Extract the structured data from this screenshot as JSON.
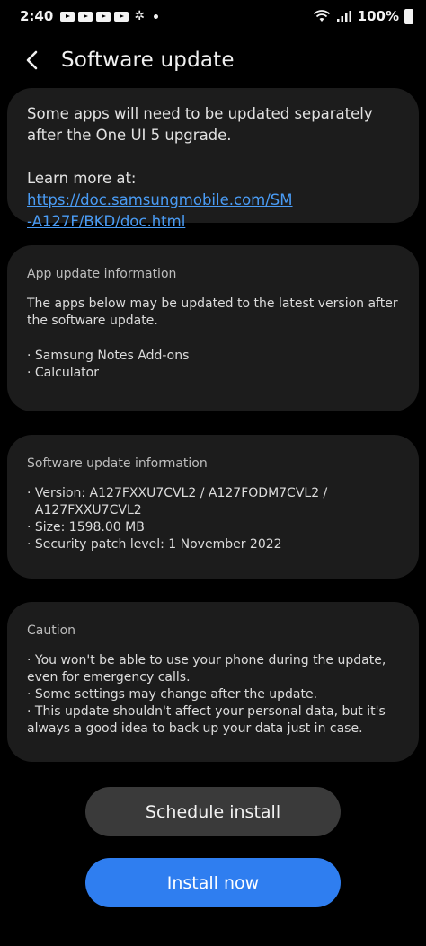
{
  "status_bar": {
    "time": "2:40",
    "battery": "100%",
    "left_icons": [
      "youtube-icon",
      "youtube-icon",
      "youtube-icon",
      "youtube-icon",
      "pinwheel-icon",
      "notification-dot-icon"
    ],
    "right_icons": [
      "wifi-icon",
      "signal-icon",
      "battery-icon"
    ]
  },
  "header": {
    "title": "Software update"
  },
  "notice_card": {
    "text": "Some apps will need to be updated separately after the One UI 5 upgrade.",
    "learn_more_label": "Learn more at: ",
    "link_line1": "https://doc.samsungmobile.com/SM",
    "link_line2": "-A127F/BKD/doc.html"
  },
  "app_update_card": {
    "title": "App update information",
    "description": "The apps below may be updated to the latest version after the software update.",
    "items": [
      "· Samsung Notes Add-ons",
      "· Calculator"
    ]
  },
  "software_info_card": {
    "title": "Software update information",
    "version_line1": "· Version: A127FXXU7CVL2 / A127FODM7CVL2 /",
    "version_line2": "  A127FXXU7CVL2",
    "size": "· Size: 1598.00 MB",
    "security_patch": "· Security patch level: 1 November 2022"
  },
  "caution_card": {
    "title": "Caution",
    "items": [
      "· You won't be able to use your phone during the update, even for emergency calls.",
      "· Some settings may change after the update.",
      "· This update shouldn't affect your personal data, but it's always a good idea to back up your data just in case."
    ]
  },
  "buttons": {
    "schedule_label": "Schedule install",
    "install_label": "Install now"
  },
  "colors": {
    "background": "#000000",
    "card": "#1c1c1c",
    "link": "#4a9cf5",
    "primary_button": "#2f7ef0",
    "secondary_button": "#3a3a3a"
  }
}
